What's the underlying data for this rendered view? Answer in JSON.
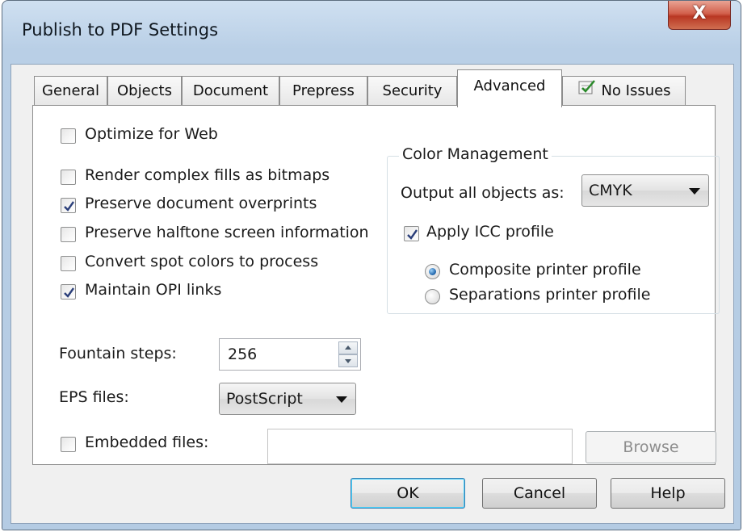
{
  "window": {
    "title": "Publish to PDF Settings",
    "close_label": "X"
  },
  "tabs": [
    {
      "label": "General"
    },
    {
      "label": "Objects"
    },
    {
      "label": "Document"
    },
    {
      "label": "Prepress"
    },
    {
      "label": "Security"
    },
    {
      "label": "Advanced"
    },
    {
      "label": "No Issues",
      "icon": "checklist-icon"
    }
  ],
  "active_tab": "Advanced",
  "options": {
    "optimize_for_web": {
      "label": "Optimize for Web",
      "checked": false
    },
    "render_complex_fills": {
      "label": "Render complex fills as bitmaps",
      "checked": false
    },
    "preserve_overprints": {
      "label": "Preserve document overprints",
      "checked": true
    },
    "preserve_halftone": {
      "label": "Preserve halftone screen information",
      "checked": false
    },
    "convert_spot_colors": {
      "label": "Convert spot colors to process",
      "checked": false
    },
    "maintain_opi": {
      "label": "Maintain OPI links",
      "checked": true
    }
  },
  "fountain_steps": {
    "label": "Fountain steps:",
    "value": "256"
  },
  "eps_files": {
    "label": "EPS files:",
    "value": "PostScript"
  },
  "embedded_files": {
    "label": "Embedded files:",
    "checked": false,
    "value": "",
    "browse_label": "Browse"
  },
  "color_management": {
    "title": "Color Management",
    "output_label": "Output all objects as:",
    "output_value": "CMYK",
    "apply_icc": {
      "label": "Apply ICC profile",
      "checked": true
    },
    "composite": {
      "label": "Composite printer profile",
      "selected": true
    },
    "separations": {
      "label": "Separations printer profile",
      "selected": false
    }
  },
  "buttons": {
    "ok": "OK",
    "cancel": "Cancel",
    "help": "Help"
  },
  "colors": {
    "window_frame": "#b9cfe6",
    "close_red": "#c4412c",
    "focus_blue": "#3c7fb1"
  }
}
